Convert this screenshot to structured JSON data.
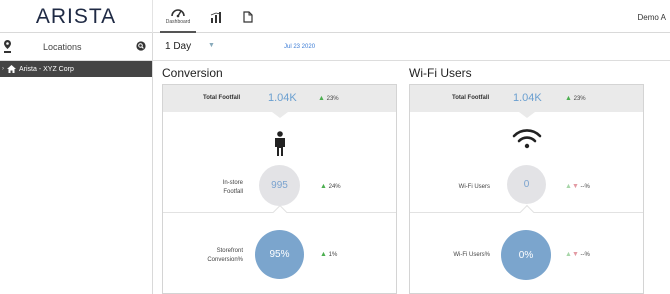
{
  "header": {
    "logo": "ARISTA",
    "nav": [
      {
        "label": "Dashboard",
        "icon": "speedometer-icon"
      },
      {
        "label": "",
        "icon": "bar-chart-icon"
      },
      {
        "label": "",
        "icon": "document-icon"
      }
    ],
    "user": "Demo A"
  },
  "sidebar": {
    "title": "Locations",
    "items": [
      {
        "label": "Arista - XYZ Corp",
        "icon": "home-icon"
      }
    ]
  },
  "toolbar": {
    "period": "1 Day",
    "date": "Jul 23 2020"
  },
  "conversion": {
    "title": "Conversion",
    "head": {
      "label": "Total Footfall",
      "value": "1.04K",
      "change": "23%"
    },
    "rows": [
      {
        "label_line1": "In-store",
        "label_line2": "Footfall",
        "value": "995",
        "change": "24%"
      },
      {
        "label_line1": "Storefront",
        "label_line2": "Conversion%",
        "value": "95%",
        "change": "1%"
      }
    ]
  },
  "wifi": {
    "title": "Wi-Fi Users",
    "head": {
      "label": "Total Footfall",
      "value": "1.04K",
      "change": "23%"
    },
    "rows": [
      {
        "label": "Wi-Fi Users",
        "value": "0",
        "change": "--%"
      },
      {
        "label": "Wi-Fi Users%",
        "value": "0%",
        "change": "--%"
      }
    ]
  },
  "colors": {
    "accent_blue": "#7ba5cd",
    "up_green": "#4caf50",
    "sidebar_selected": "#444444"
  }
}
